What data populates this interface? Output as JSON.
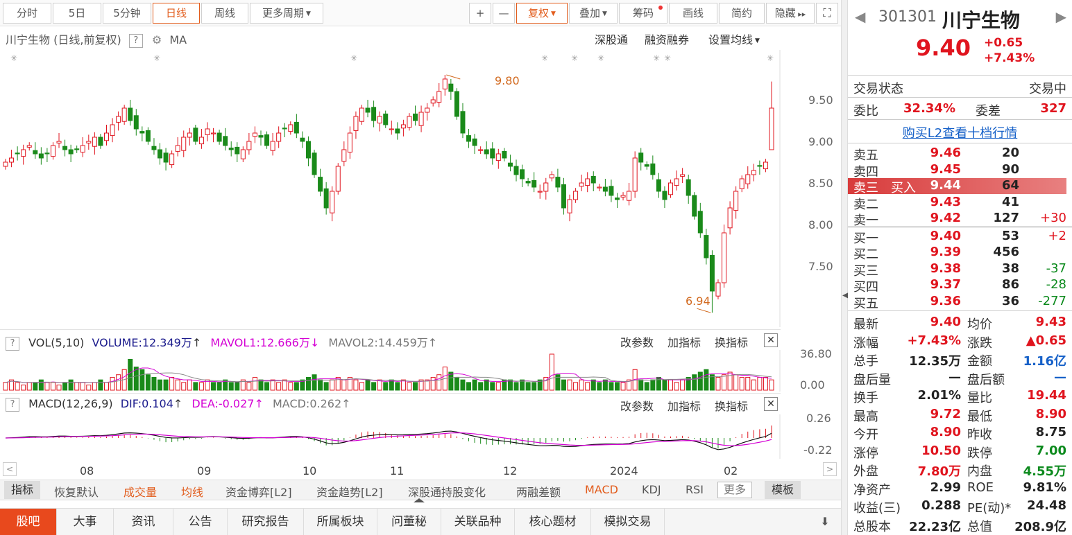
{
  "toolbar": {
    "tabs": [
      "分时",
      "5日",
      "5分钟",
      "日线",
      "周线",
      "更多周期"
    ],
    "active": "日线",
    "right": [
      "复权",
      "叠加",
      "筹码",
      "画线",
      "简约",
      "隐藏"
    ],
    "plus": "+",
    "minus": "—"
  },
  "chart": {
    "title": "川宁生物",
    "title_paren": "(日线,前复权)",
    "q": "?",
    "ma": "MA",
    "links": [
      "深股通",
      "融资融券",
      "设置均线"
    ],
    "price_labels": [
      "9.50",
      "9.00",
      "8.50",
      "8.00",
      "7.50"
    ],
    "high_annot": "9.80",
    "low_annot": "6.94",
    "high": 9.8,
    "low": 6.94,
    "last_close": 9.4,
    "closes": [
      8.75,
      8.8,
      8.85,
      8.9,
      8.95,
      8.85,
      8.8,
      8.85,
      8.95,
      9.0,
      8.9,
      8.85,
      8.9,
      8.95,
      9.0,
      9.05,
      8.95,
      9.1,
      9.2,
      9.3,
      9.4,
      9.25,
      9.15,
      9.1,
      9.0,
      8.9,
      8.8,
      8.75,
      8.85,
      8.95,
      9.05,
      9.1,
      9.0,
      9.05,
      9.15,
      9.1,
      9.0,
      8.95,
      8.9,
      8.85,
      8.9,
      9.0,
      9.1,
      9.05,
      8.95,
      9.0,
      9.1,
      9.15,
      9.2,
      9.1,
      9.0,
      8.8,
      8.6,
      8.4,
      8.2,
      8.4,
      8.7,
      8.9,
      9.1,
      9.3,
      9.4,
      9.35,
      9.25,
      9.3,
      9.2,
      9.15,
      9.1,
      9.2,
      9.3,
      9.25,
      9.35,
      9.4,
      9.5,
      9.6,
      9.75,
      9.6,
      9.3,
      9.1,
      9.0,
      8.95,
      8.9,
      8.85,
      8.8,
      8.85,
      8.8,
      8.7,
      8.6,
      8.55,
      8.5,
      8.45,
      8.4,
      8.5,
      8.6,
      8.45,
      8.2,
      8.3,
      8.4,
      8.5,
      8.55,
      8.5,
      8.45,
      8.4,
      8.35,
      8.3,
      8.35,
      8.4,
      8.8,
      8.75,
      8.7,
      8.6,
      8.4,
      8.3,
      8.5,
      8.55,
      8.6,
      8.35,
      8.1,
      7.9,
      7.6,
      7.2,
      7.3,
      7.9,
      8.2,
      8.4,
      8.55,
      8.6,
      8.65,
      8.7,
      8.75,
      9.4
    ]
  },
  "vol": {
    "name": "VOL(5,10)",
    "volume": "VOLUME:12.349万",
    "mavol1": "MAVOL1:12.666万",
    "mavol2": "MAVOL2:14.459万",
    "arrow_up": "↑",
    "arrow_down": "↓",
    "labels": [
      "36.80",
      "0.00"
    ],
    "values": [
      3,
      4,
      3,
      2,
      3,
      3,
      4,
      3,
      3,
      2,
      3,
      4,
      3,
      3,
      2,
      3,
      4,
      3,
      5,
      6,
      8,
      12,
      9,
      8,
      6,
      5,
      4,
      4,
      5,
      4,
      3,
      4,
      3,
      3,
      4,
      3,
      3,
      4,
      3,
      3,
      4,
      3,
      5,
      4,
      3,
      4,
      3,
      4,
      3,
      3,
      4,
      5,
      6,
      4,
      3,
      4,
      5,
      4,
      5,
      4,
      3,
      4,
      3,
      4,
      3,
      4,
      3,
      4,
      3,
      3,
      4,
      4,
      5,
      6,
      9,
      7,
      5,
      4,
      3,
      4,
      3,
      4,
      3,
      3,
      4,
      4,
      3,
      4,
      3,
      3,
      4,
      5,
      14,
      6,
      4,
      4,
      3,
      4,
      3,
      4,
      3,
      4,
      3,
      3,
      3,
      4,
      8,
      4,
      3,
      4,
      5,
      4,
      4,
      3,
      4,
      5,
      6,
      7,
      8,
      6,
      5,
      6,
      7,
      6,
      5,
      5,
      4,
      5,
      5,
      4
    ]
  },
  "macd": {
    "name": "MACD(12,26,9)",
    "dif": "DIF:0.104",
    "dea": "DEA:-0.027",
    "macd": "MACD:0.262",
    "labels": [
      "0.26",
      "-0.22"
    ]
  },
  "ind_buttons": [
    "改参数",
    "加指标",
    "换指标"
  ],
  "months": [
    "08",
    "09",
    "10",
    "11",
    "12",
    "2024",
    "02"
  ],
  "navbar": {
    "items": [
      "指标",
      "恢复默认",
      "成交量",
      "均线",
      "资金博弈[L2]",
      "资金趋势[L2]",
      "深股通持股变化",
      "两融差额",
      "MACD",
      "KDJ",
      "RSI",
      "更多",
      "模板"
    ]
  },
  "bottombar": {
    "items": [
      "股吧",
      "大事",
      "资讯",
      "公告",
      "研究报告",
      "所属板块",
      "问董秘",
      "关联品种",
      "核心题材",
      "模拟交易"
    ]
  },
  "quote": {
    "code": "301301",
    "name": "川宁生物",
    "price": "9.40",
    "change": "+0.65",
    "change_pct": "+7.43%",
    "status_label": "交易状态",
    "status": "交易中",
    "weibi_label": "委比",
    "weibi": "32.34%",
    "weicha_label": "委差",
    "weicha": "327",
    "l2_link": "购买L2查看十档行情",
    "sells": [
      {
        "label": "卖五",
        "price": "9.46",
        "vol": "20",
        "chg": ""
      },
      {
        "label": "卖四",
        "price": "9.45",
        "vol": "90",
        "chg": ""
      },
      {
        "label": "卖三",
        "price": "9.44",
        "vol": "64",
        "chg": ""
      },
      {
        "label": "卖二",
        "price": "9.43",
        "vol": "41",
        "chg": ""
      },
      {
        "label": "卖一",
        "price": "9.42",
        "vol": "127",
        "chg": "+30"
      }
    ],
    "buy_overlay": "买入",
    "buys": [
      {
        "label": "买一",
        "price": "9.40",
        "vol": "53",
        "chg": "+2"
      },
      {
        "label": "买二",
        "price": "9.39",
        "vol": "456",
        "chg": ""
      },
      {
        "label": "买三",
        "price": "9.38",
        "vol": "38",
        "chg": "-37"
      },
      {
        "label": "买四",
        "price": "9.37",
        "vol": "86",
        "chg": "-28"
      },
      {
        "label": "买五",
        "price": "9.36",
        "vol": "36",
        "chg": "-277"
      }
    ],
    "stats": [
      [
        {
          "k": "最新",
          "v": "9.40",
          "c": "red"
        },
        {
          "k": "均价",
          "v": "9.43",
          "c": "red"
        }
      ],
      [
        {
          "k": "涨幅",
          "v": "+7.43%",
          "c": "red"
        },
        {
          "k": "涨跌",
          "v": "▲0.65",
          "c": "red"
        }
      ],
      [
        {
          "k": "总手",
          "v": "12.35万",
          "c": "dark"
        },
        {
          "k": "金额",
          "v": "1.16亿",
          "c": "blue"
        }
      ],
      [
        {
          "k": "盘后量",
          "v": "—",
          "c": "dark"
        },
        {
          "k": "盘后额",
          "v": "—",
          "c": "blue"
        }
      ],
      [
        {
          "k": "换手",
          "v": "2.01%",
          "c": "dark"
        },
        {
          "k": "量比",
          "v": "19.44",
          "c": "red"
        }
      ],
      [
        {
          "k": "最高",
          "v": "9.72",
          "c": "red"
        },
        {
          "k": "最低",
          "v": "8.90",
          "c": "red"
        }
      ],
      [
        {
          "k": "今开",
          "v": "8.90",
          "c": "red"
        },
        {
          "k": "昨收",
          "v": "8.75",
          "c": "dark"
        }
      ],
      [
        {
          "k": "涨停",
          "v": "10.50",
          "c": "red"
        },
        {
          "k": "跌停",
          "v": "7.00",
          "c": "green"
        }
      ],
      [
        {
          "k": "外盘",
          "v": "7.80万",
          "c": "red"
        },
        {
          "k": "内盘",
          "v": "4.55万",
          "c": "green"
        }
      ],
      [
        {
          "k": "净资产",
          "v": "2.99",
          "c": "dark"
        },
        {
          "k": "ROE",
          "v": "9.81%",
          "c": "dark"
        }
      ],
      [
        {
          "k": "收益(三)",
          "v": "0.288",
          "c": "dark"
        },
        {
          "k": "PE(动)*",
          "v": "24.48",
          "c": "dark"
        }
      ],
      [
        {
          "k": "总股本",
          "v": "22.23亿",
          "c": "dark"
        },
        {
          "k": "总值",
          "v": "208.9亿",
          "c": "dark"
        }
      ]
    ]
  }
}
